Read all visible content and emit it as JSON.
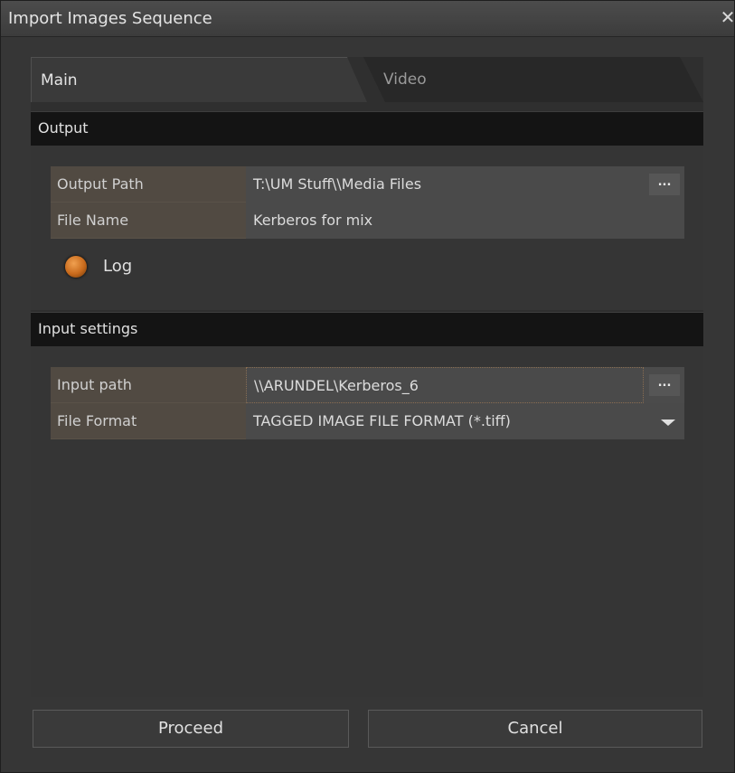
{
  "window": {
    "title": "Import Images Sequence",
    "close_label": "✕"
  },
  "tabs": [
    {
      "label": "Main",
      "active": true
    },
    {
      "label": "Video",
      "active": false
    }
  ],
  "output": {
    "header": "Output",
    "output_path_label": "Output Path",
    "output_path_value": "T:\\UM Stuff\\\\Media Files",
    "file_name_label": "File Name",
    "file_name_value": "Kerberos for mix",
    "browse_label": "...",
    "log_label": "Log"
  },
  "input": {
    "header": "Input settings",
    "input_path_label": "Input path",
    "input_path_value": "\\\\ARUNDEL\\Kerberos_6",
    "browse_label": "...",
    "file_format_label": "File Format",
    "file_format_value": "TAGGED IMAGE FILE FORMAT (*.tiff)"
  },
  "footer": {
    "proceed_label": "Proceed",
    "cancel_label": "Cancel"
  },
  "colors": {
    "accent": "#c86a1c",
    "header_bg": "#141414",
    "label_bg": "#514a42"
  }
}
